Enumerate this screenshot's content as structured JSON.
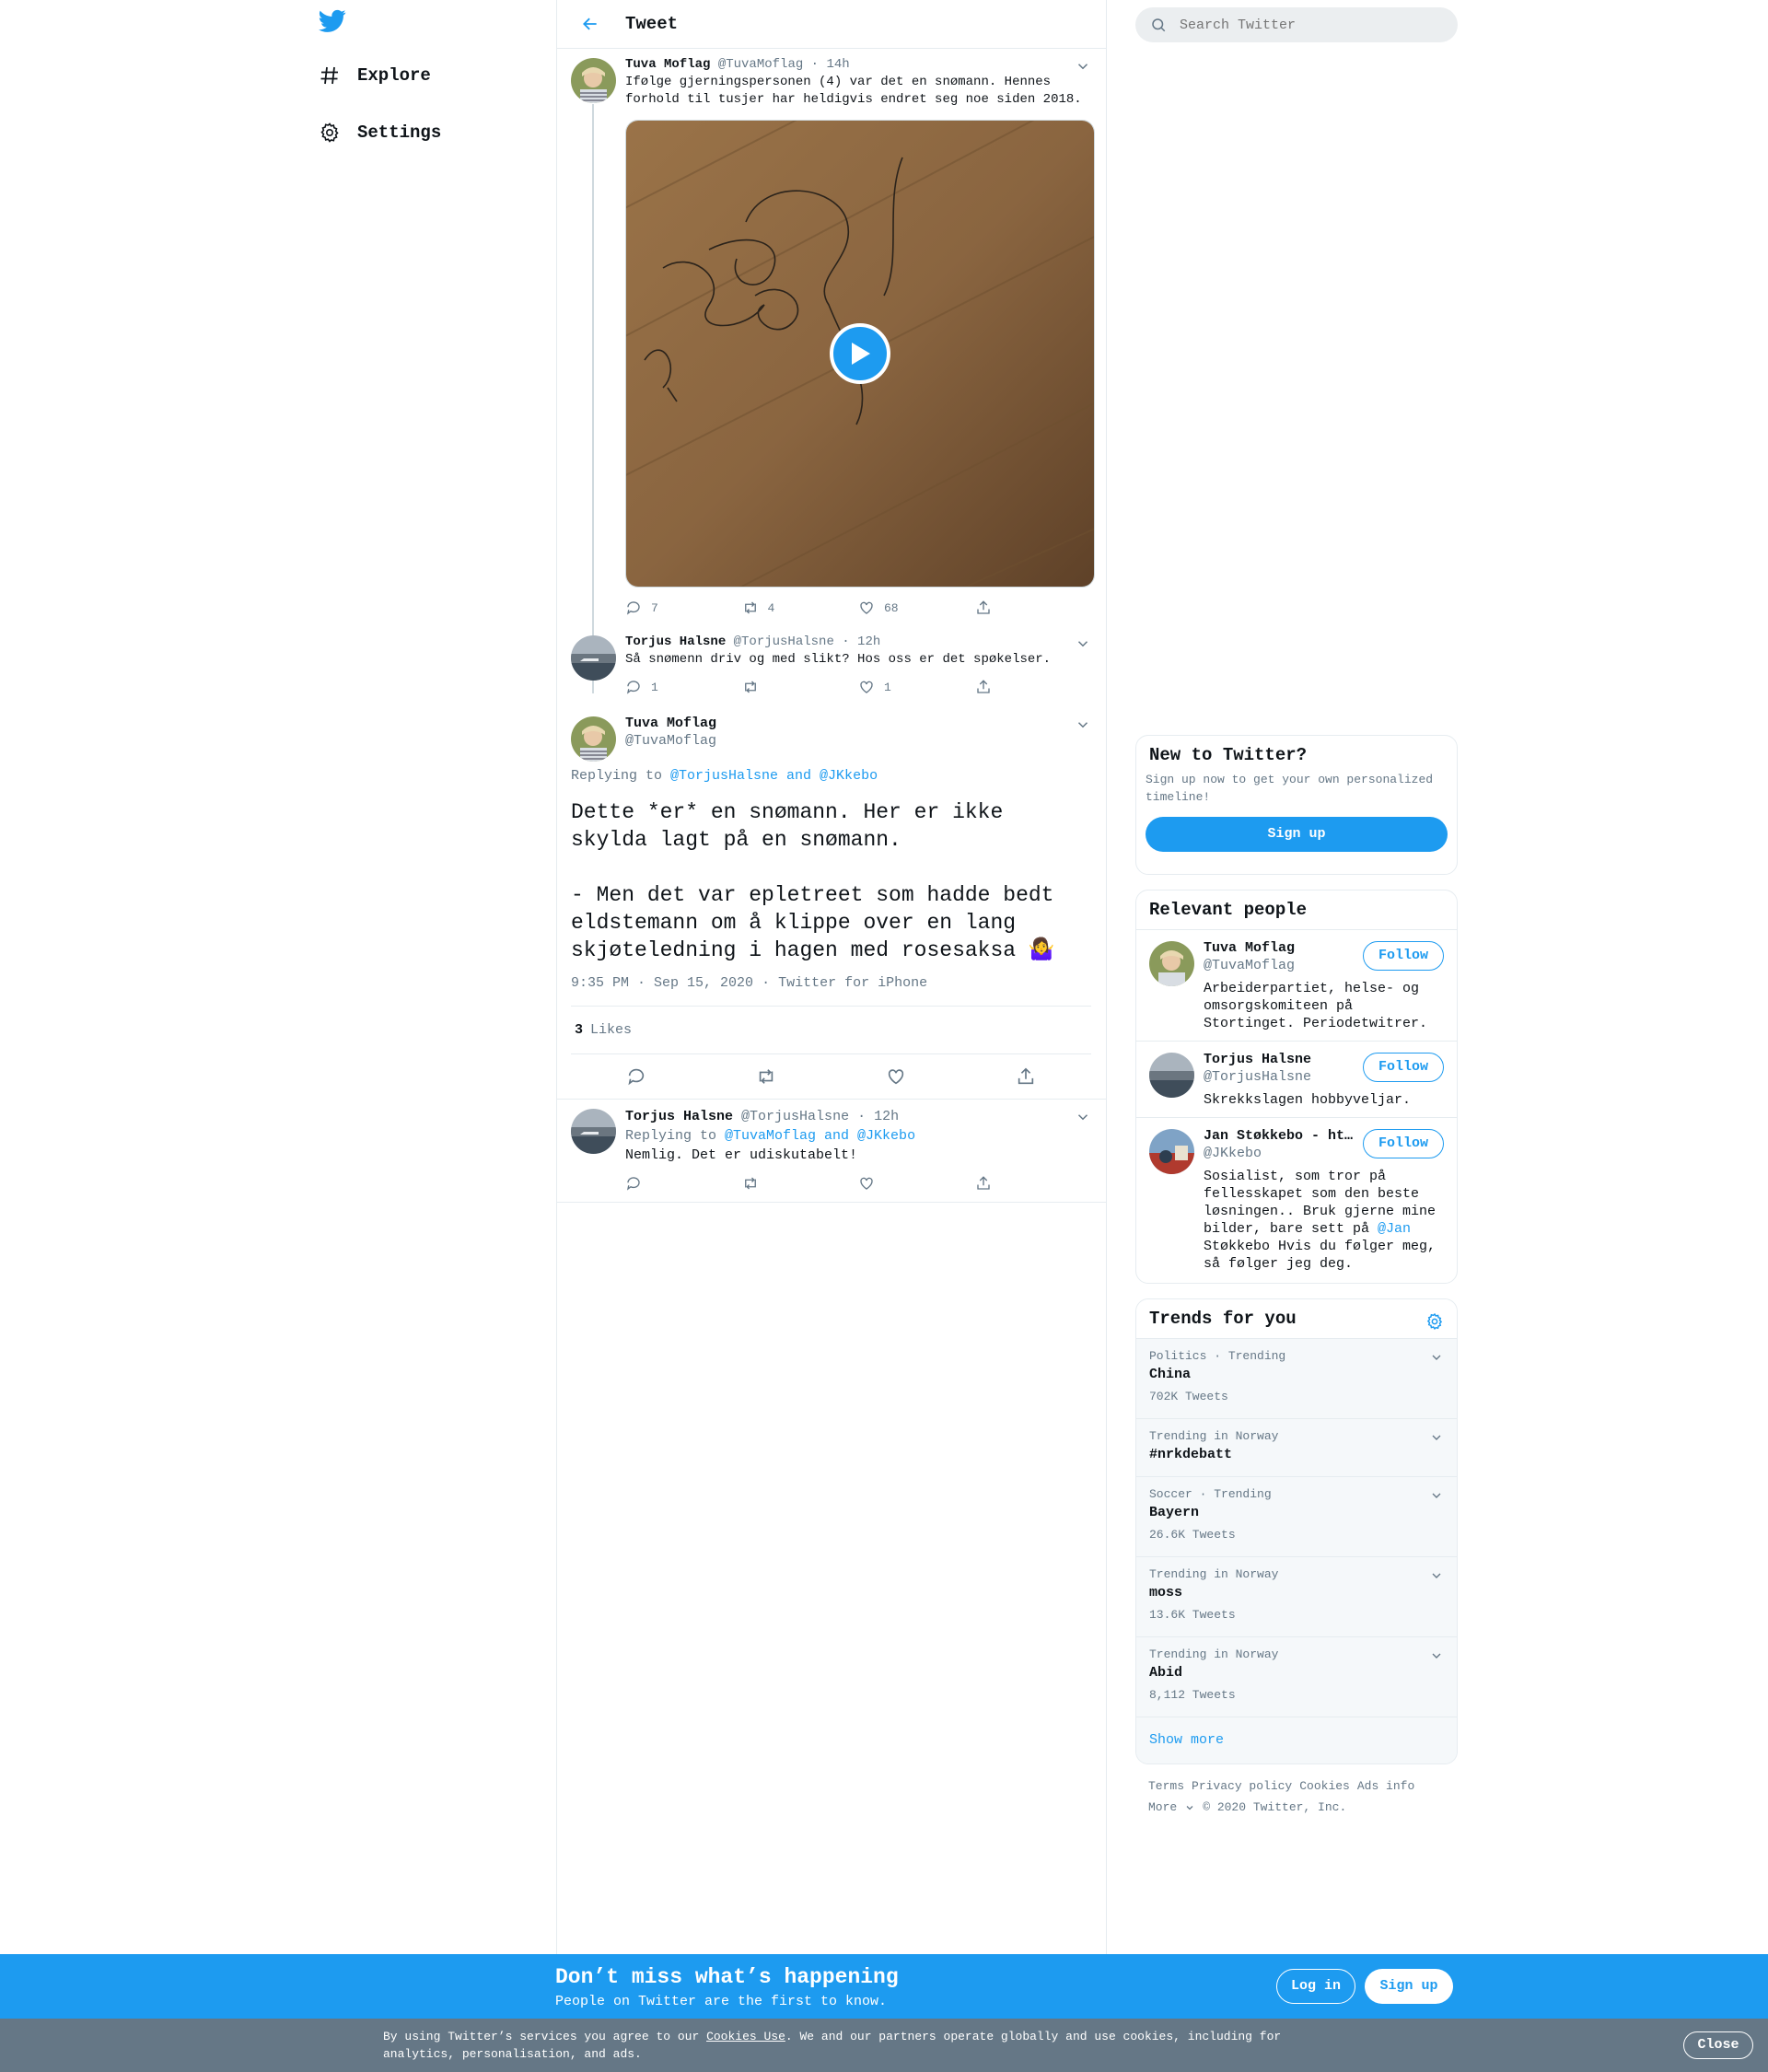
{
  "nav": {
    "explore": "Explore",
    "settings": "Settings"
  },
  "header": {
    "title": "Tweet"
  },
  "thread": [
    {
      "name": "Tuva Moflag",
      "handle": "@TuvaMoflag",
      "time": "· 14h",
      "text": "Ifølge gjerningspersonen (4) var det en snømann. Hennes forhold til tusjer har heldigvis endret seg noe siden 2018.",
      "replies": "7",
      "retweets": "4",
      "likes": "68"
    },
    {
      "name": "Torjus Halsne",
      "handle": "@TorjusHalsne",
      "time": "· 12h",
      "text": "Så snømenn driv og med slikt? Hos oss er det spøkelser.",
      "replies": "1",
      "retweets": "",
      "likes": "1"
    }
  ],
  "main_tweet": {
    "name": "Tuva Moflag",
    "handle": "@TuvaMoflag",
    "replying_prefix": "Replying to ",
    "replying_to": "@TorjusHalsne and @JKkebo",
    "text": "Dette *er* en snømann. Her er ikke skylda lagt på en snømann.\n\n- Men det var epletreet som hadde bedt eldstemann om å klippe over en lang skjøteledning i hagen med rosesaksa 🤷‍♀️",
    "timestamp": "9:35 PM · Sep 15, 2020",
    "source": "· Twitter for iPhone",
    "likes_count": "3",
    "likes_label": "Likes"
  },
  "reply": {
    "name": "Torjus Halsne",
    "handle": "@TorjusHalsne",
    "time": "· 12h",
    "replying_prefix": "Replying to ",
    "replying_to": "@TuvaMoflag and @JKkebo",
    "text": "Nemlig. Det er udiskutabelt!"
  },
  "search": {
    "placeholder": "Search Twitter"
  },
  "new_to_twitter": {
    "title": "New to Twitter?",
    "desc": "Sign up now to get your own personalized timeline!",
    "button": "Sign up"
  },
  "relevant_people": {
    "title": "Relevant people",
    "follow_label": "Follow",
    "people": [
      {
        "name": "Tuva Moflag",
        "handle": "@TuvaMoflag",
        "bio": "Arbeiderpartiet, helse- og omsorgskomiteen på Stortinget. Periodetwitrer."
      },
      {
        "name": "Torjus Halsne",
        "handle": "@TorjusHalsne",
        "bio": "Skrekkslagen hobbyveljar."
      },
      {
        "name": "Jan Støkkebo - ht…",
        "handle": "@JKkebo",
        "bio_pre": "Sosialist, som tror på fellesskapet som den beste løsningen.. Bruk gjerne mine bilder, bare sett på ",
        "bio_link": "@Jan",
        "bio_post": " Støkkebo Hvis du følger meg, så følger jeg deg."
      }
    ]
  },
  "trends": {
    "title": "Trends for you",
    "items": [
      {
        "context": "Politics · Trending",
        "name": "China",
        "count": "702K Tweets"
      },
      {
        "context": "Trending in Norway",
        "name": "#nrkdebatt",
        "count": ""
      },
      {
        "context": "Soccer · Trending",
        "name": "Bayern",
        "count": "26.6K Tweets"
      },
      {
        "context": "Trending in Norway",
        "name": "moss",
        "count": "13.6K Tweets"
      },
      {
        "context": "Trending in Norway",
        "name": "Abid",
        "count": "8,112 Tweets"
      }
    ],
    "show_more": "Show more"
  },
  "footer": {
    "links": [
      "Terms",
      "Privacy policy",
      "Cookies",
      "Ads info"
    ],
    "more": "More",
    "copyright": "© 2020 Twitter, Inc."
  },
  "banner": {
    "headline": "Don’t miss what’s happening",
    "sub": "People on Twitter are the first to know.",
    "login": "Log in",
    "signup": "Sign up"
  },
  "cookie": {
    "pre": "By using Twitter’s services you agree to our ",
    "link": "Cookies Use",
    "post": ". We and our partners operate globally and use cookies, including for analytics, personalisation, and ads.",
    "close": "Close"
  },
  "colors": {
    "accent": "#1d9bf0",
    "text": "#0f1419",
    "secondary": "#657786"
  }
}
